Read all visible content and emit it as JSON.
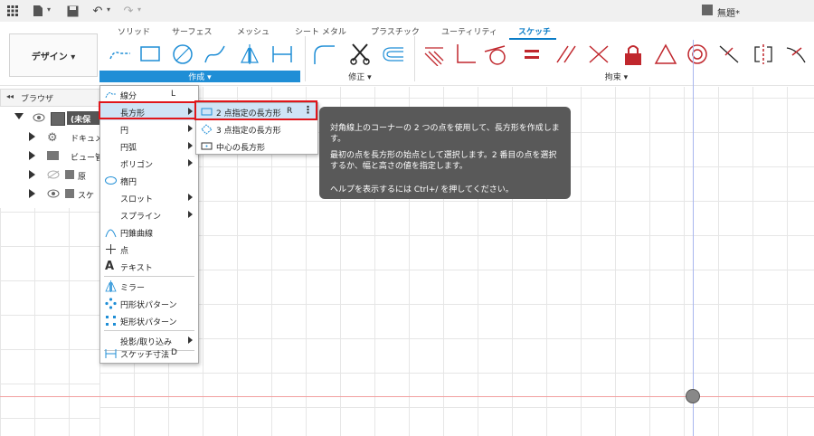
{
  "titlebar": {
    "document_title": "無題*"
  },
  "tabs": [
    "ソリッド",
    "サーフェス",
    "メッシュ",
    "シート メタル",
    "プラスチック",
    "ユーティリティ",
    "スケッチ"
  ],
  "active_tab": "スケッチ",
  "ribbon": {
    "design_button": "デザイン ▾",
    "create_label": "作成 ▾",
    "modify_label": "修正 ▾",
    "constrain_label": "拘束 ▾"
  },
  "browser": {
    "title": "ブラウザ",
    "items": [
      "(未保",
      "ドキュメン",
      "ビュー管理",
      "原",
      "スケ"
    ]
  },
  "create_menu": [
    {
      "label": "線分",
      "shortcut": "L",
      "submenu": false
    },
    {
      "label": "長方形",
      "shortcut": "",
      "submenu": true
    },
    {
      "label": "円",
      "shortcut": "",
      "submenu": true
    },
    {
      "label": "円弧",
      "shortcut": "",
      "submenu": true
    },
    {
      "label": "ポリゴン",
      "shortcut": "",
      "submenu": true
    },
    {
      "label": "楕円",
      "shortcut": "",
      "submenu": false
    },
    {
      "label": "スロット",
      "shortcut": "",
      "submenu": true
    },
    {
      "label": "スプライン",
      "shortcut": "",
      "submenu": true
    },
    {
      "label": "円錐曲線",
      "shortcut": "",
      "submenu": false
    },
    {
      "label": "点",
      "shortcut": "",
      "submenu": false
    },
    {
      "label": "テキスト",
      "shortcut": "",
      "submenu": false
    },
    {
      "label": "ミラー",
      "shortcut": "",
      "submenu": false
    },
    {
      "label": "円形状パターン",
      "shortcut": "",
      "submenu": false
    },
    {
      "label": "矩形状パターン",
      "shortcut": "",
      "submenu": false
    },
    {
      "label": "投影/取り込み",
      "shortcut": "",
      "submenu": true
    },
    {
      "label": "スケッチ寸法",
      "shortcut": "D",
      "submenu": false
    }
  ],
  "rect_submenu": [
    {
      "label": "2 点指定の長方形",
      "shortcut": "R"
    },
    {
      "label": "3 点指定の長方形",
      "shortcut": ""
    },
    {
      "label": "中心の長方形",
      "shortcut": ""
    }
  ],
  "tooltip": {
    "line1": "対角線上のコーナーの 2 つの点を使用して、長方形を作成します。",
    "line2": "最初の点を長方形の始点として選択します。2 番目の点を選択するか、幅と高さの値を指定します。",
    "line3": "ヘルプを表示するには Ctrl+/ を押してください。"
  },
  "colors": {
    "accent": "#1f8ed6",
    "highlight_box": "#e0161b",
    "constraint_red": "#c0272d"
  }
}
